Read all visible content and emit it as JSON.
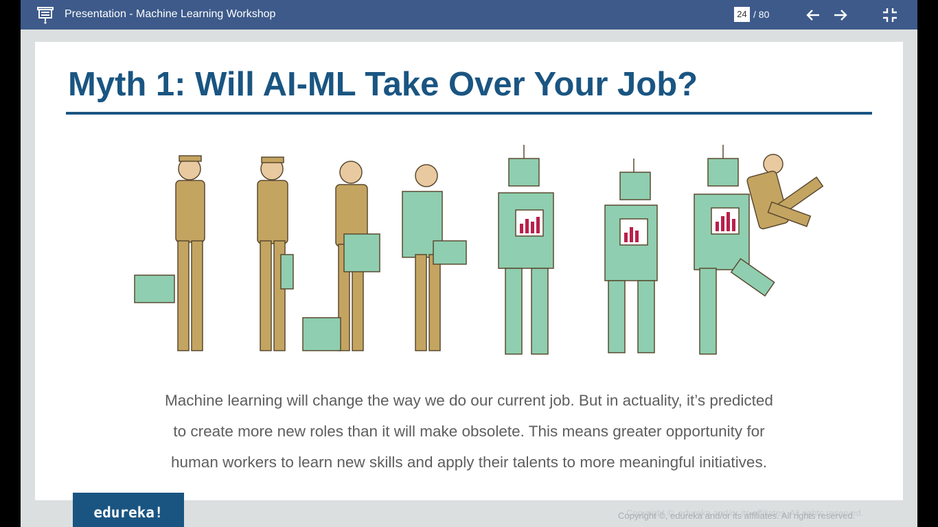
{
  "toolbar": {
    "title": "Presentation - Machine Learning Workshop",
    "current_page": "24",
    "total_pages": "/ 80",
    "icons": {
      "presentation": "presentation-icon",
      "prev": "arrow-left-icon",
      "next": "arrow-right-icon",
      "collapse": "exit-fullscreen-icon"
    }
  },
  "slide": {
    "title": "Myth 1: Will AI-ML Take Over Your Job?",
    "body_lines": [
      "Machine learning will change the way we do our current job. But in actuality, it’s predicted",
      "to create more new roles than it will make obsolete. This means greater opportunity for",
      "human workers to learn new skills and apply their talents to more meaningful initiatives."
    ],
    "logo": "edureka!",
    "copyright": "Copyright ©, edureka and/or its affiliates. All rights reserved."
  },
  "colors": {
    "toolbar_bg": "#3d5a8a",
    "title_blue": "#1a5582",
    "worker_khaki": "#c4a461",
    "robot_green": "#8fceb0"
  }
}
